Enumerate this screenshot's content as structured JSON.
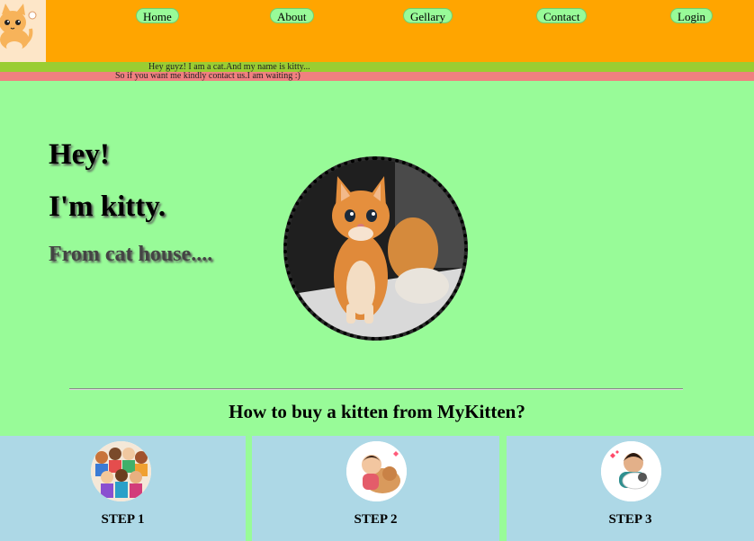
{
  "header": {
    "logo_alt": "cat logo",
    "nav": [
      "Home",
      "About",
      "Gellary",
      "Contact",
      "Login"
    ]
  },
  "marquee": {
    "line1": "Hey guyz! I am a cat.And my name is kitty...",
    "line2": "So if you want me kindly contact us.I am waiting :)"
  },
  "hero": {
    "greeting": "Hey!",
    "name": "I'm kitty.",
    "origin": "From cat house...."
  },
  "section": {
    "title": "How to buy a kitten from MyKitten?"
  },
  "steps": [
    {
      "label": "STEP 1",
      "icon": "people-crowd-icon"
    },
    {
      "label": "STEP 2",
      "icon": "person-with-dog-icon"
    },
    {
      "label": "STEP 3",
      "icon": "person-hugging-cat-icon"
    }
  ],
  "colors": {
    "page_bg": "#98fb98",
    "header_bg": "#ffa500",
    "marquee1_bg": "#9acd32",
    "marquee2_bg": "#f08080",
    "card_bg": "#add8e6"
  }
}
